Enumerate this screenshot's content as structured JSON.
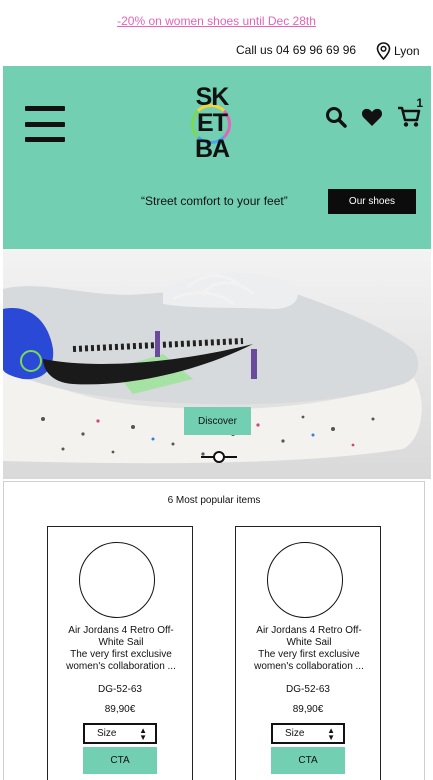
{
  "promo": {
    "text": "-20% on women shoes until Dec 28th"
  },
  "topbar": {
    "call_text": "Call us 04 69 96 69 96",
    "location": "Lyon",
    "location_icon": "location-pin-icon"
  },
  "header": {
    "menu_icon": "hamburger-menu-icon",
    "logo": {
      "line1": "SK",
      "line2": "ET",
      "line3": "BA"
    },
    "icons": [
      "search-icon",
      "heart-icon",
      "cart-icon"
    ],
    "cart_count": "1",
    "slogan": "“Street comfort to your feet”",
    "shoes_button": "Our shoes",
    "accent_color": "#72cfb2"
  },
  "banner": {
    "discover_label": "Discover",
    "slider_icon": "slider-handle-icon"
  },
  "popular": {
    "title": "6 Most popular items",
    "items": [
      {
        "name": "Air Jordans 4 Retro Off-White Sail",
        "description": "The very first exclusive women's collaboration ...",
        "ref": "DG-52-63",
        "price": "89,90€",
        "size_label": "Size",
        "cta": "CTA"
      },
      {
        "name": "Air Jordans 4 Retro Off-White Sail",
        "description": "The very first exclusive women's collaboration ...",
        "ref": "DG-52-63",
        "price": "89,90€",
        "size_label": "Size",
        "cta": "CTA"
      }
    ]
  }
}
